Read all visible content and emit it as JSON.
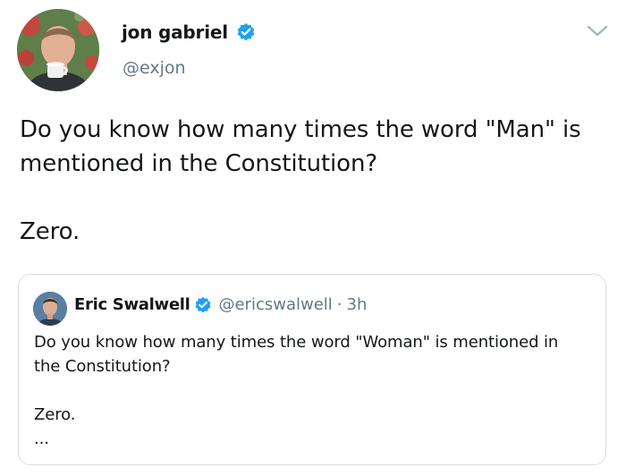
{
  "tweet": {
    "author": {
      "display_name": "jon gabriel",
      "handle": "@exjon",
      "verified": true,
      "avatar_icon": "profile-photo"
    },
    "menu_icon": "chevron-down-icon",
    "text": "Do you know how many times the word \"Man\" is\nmentioned in the Constitution?\n\nZero."
  },
  "quoted_tweet": {
    "author": {
      "display_name": "Eric Swalwell",
      "handle": "@ericswalwell",
      "verified": true,
      "avatar_icon": "profile-photo"
    },
    "separator": "·",
    "time": "3h",
    "text": "Do you know how many times the word \"Woman\" is mentioned in\nthe Constitution?\n\nZero.\n..."
  },
  "colors": {
    "verified_blue": "#1da1f2",
    "secondary_text": "#657786",
    "border": "#d7dde2"
  }
}
